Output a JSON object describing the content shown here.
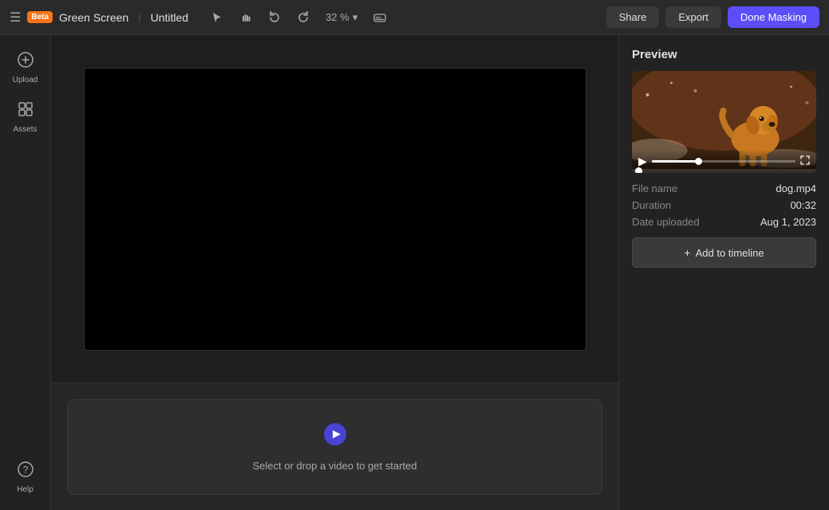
{
  "topbar": {
    "beta_label": "Beta",
    "app_title": "Green Screen",
    "divider": "|",
    "doc_title": "Untitled",
    "zoom": "32 %",
    "share_label": "Share",
    "export_label": "Export",
    "done_label": "Done Masking"
  },
  "sidebar": {
    "upload_label": "Upload",
    "assets_label": "Assets",
    "help_label": "Help"
  },
  "canvas": {
    "bg_color": "#000000"
  },
  "timeline": {
    "drop_text": "Select or drop a video to get started"
  },
  "panel": {
    "title": "Preview",
    "file_name_label": "File name",
    "file_name_value": "dog.mp4",
    "duration_label": "Duration",
    "duration_value": "00:32",
    "date_label": "Date uploaded",
    "date_value": "Aug 1, 2023",
    "add_timeline_label": "Add to timeline",
    "play_icon": "▶",
    "fullscreen_icon": "⛶",
    "plus_icon": "+"
  },
  "icons": {
    "hamburger": "☰",
    "select_tool": "⬡",
    "hand_tool": "✋",
    "undo": "↩",
    "redo": "↪",
    "chevron_down": "▾",
    "subtitles": "⬒",
    "upload_icon": "+",
    "assets_icon": "⬜",
    "help_icon": "?"
  }
}
